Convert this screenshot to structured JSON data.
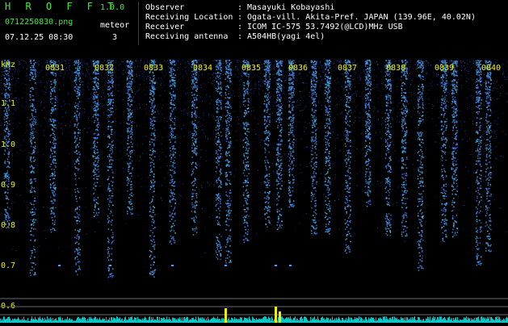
{
  "app": {
    "title": "H R O F F T",
    "version": "1.0.0",
    "file_name": "0712250830.png",
    "meteor_label": "meteor",
    "timestamp": "07.12.25 08:30",
    "meteor_count": "3"
  },
  "info": [
    {
      "label": "Observer",
      "colon": ":",
      "value": "Masayuki Kobayashi"
    },
    {
      "label": "Receiving Location",
      "colon": ":",
      "value": "Ogata-vill. Akita-Pref. JAPAN (139.96E, 40.02N)"
    },
    {
      "label": "Receiver",
      "colon": ":",
      "value": "ICOM IC-575 53.7492(@LCD)MHz USB"
    },
    {
      "label": "Receiving antenna",
      "colon": ":",
      "value": "A504HB(yagi 4el)"
    }
  ],
  "axis": {
    "unit": "kHz",
    "y_ticks": [
      "1.1",
      "1.0",
      "0.9",
      "0.8",
      "0.7",
      "0.6"
    ],
    "time_labels": [
      "0831",
      "0832",
      "0833",
      "0834",
      "0835",
      "0836",
      "0837",
      "0838",
      "0839",
      "0840"
    ]
  },
  "colors": {
    "background": "#000000",
    "header_text": "#3cf03c",
    "axis_text": "#f0f000",
    "signal": "#2850ff",
    "activity": "#00c8c8"
  }
}
